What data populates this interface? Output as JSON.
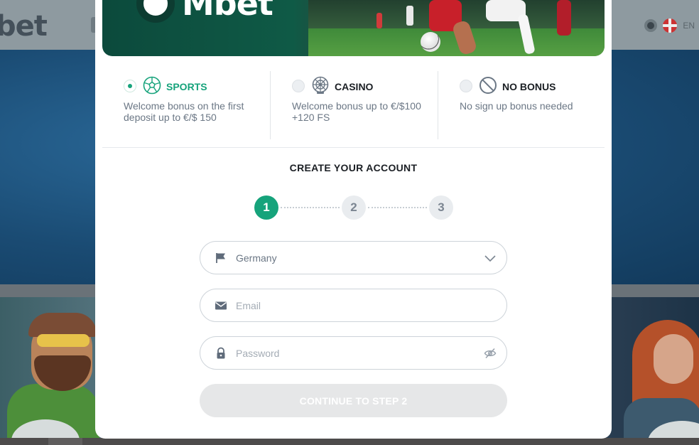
{
  "background": {
    "logo_text": "bet",
    "language": "EN"
  },
  "banner": {
    "logo_text": "Mbet"
  },
  "bonuses": [
    {
      "title": "SPORTS",
      "description": "Welcome bonus on the first deposit up to €/$ 150",
      "icon": "soccer-ball-icon",
      "selected": true
    },
    {
      "title": "CASINO",
      "description": "Welcome bonus up to €/$100 +120 FS",
      "icon": "roulette-wheel-icon",
      "selected": false
    },
    {
      "title": "NO BONUS",
      "description": "No sign up bonus needed",
      "icon": "prohibited-icon",
      "selected": false
    }
  ],
  "form": {
    "heading": "CREATE YOUR ACCOUNT",
    "steps": [
      "1",
      "2",
      "3"
    ],
    "active_step": "1",
    "country": {
      "value": "Germany",
      "icon": "flag-icon"
    },
    "email": {
      "placeholder": "Email",
      "icon": "envelope-icon"
    },
    "password": {
      "placeholder": "Password",
      "icon": "lock-icon",
      "toggle_icon": "eye-slash-icon"
    },
    "continue_label": "CONTINUE TO STEP 2"
  },
  "colors": {
    "accent": "#16a37b",
    "disabled_button": "#e6e7e8",
    "text_muted": "#6b7785"
  }
}
